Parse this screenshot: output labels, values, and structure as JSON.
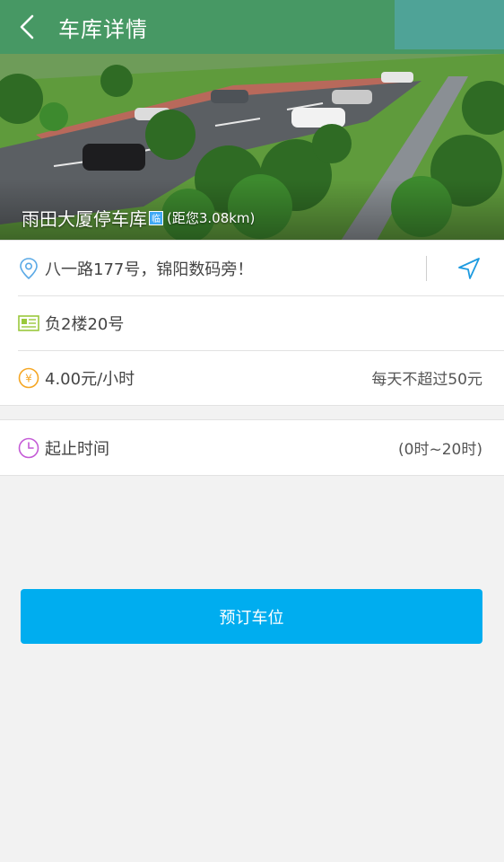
{
  "header": {
    "title": "车库详情"
  },
  "garage": {
    "name": "雨田大厦停车库",
    "tag_icon_text": "临",
    "distance": "(距您3.08km)"
  },
  "details": {
    "address": "八一路177号，锦阳数码旁！",
    "floor": "负2楼20号",
    "price": "4.00元/小时",
    "price_cap": "每天不超过50元"
  },
  "hours": {
    "label": "起止时间",
    "value": "(0时~20时)"
  },
  "actions": {
    "book_label": "预订车位"
  },
  "icons": {
    "back": "back-arrow-icon",
    "location": "location-pin-icon",
    "navigate": "navigation-arrow-icon",
    "floor": "floor-card-icon",
    "price": "yuan-coin-icon",
    "clock": "clock-icon"
  },
  "colors": {
    "accent": "#00adef",
    "nav_blue": "#1e9be0",
    "location_blue": "#5aa9e6",
    "floor_green": "#9ac83c",
    "price_orange": "#f5a623",
    "clock_purple": "#c45ad6"
  }
}
